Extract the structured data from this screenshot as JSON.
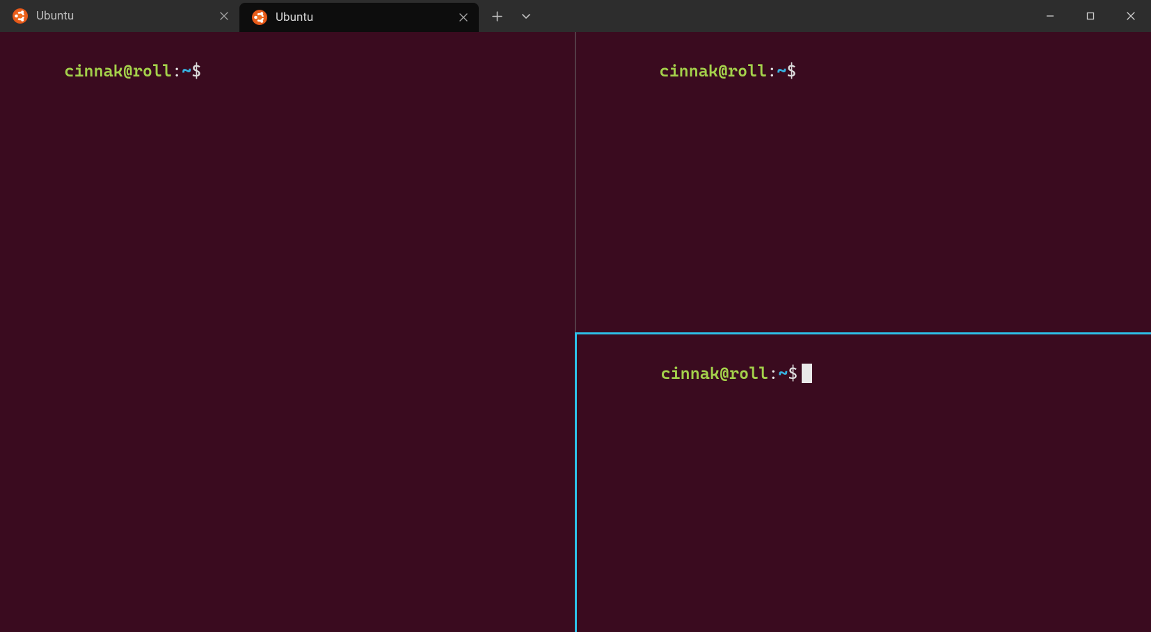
{
  "tabs": [
    {
      "label": "Ubuntu",
      "active": false
    },
    {
      "label": "Ubuntu",
      "active": true
    }
  ],
  "prompt": {
    "userhost": "cinnak@roll",
    "sep": ":",
    "path": "~",
    "sigil": "$"
  },
  "panes": {
    "left": {
      "has_cursor": false
    },
    "right_top": {
      "has_cursor": false
    },
    "right_bottom": {
      "has_cursor": true
    }
  },
  "colors": {
    "terminal_bg": "#3a0b1f",
    "accent": "#2dc0e8",
    "prompt_user": "#a4d14b",
    "prompt_path": "#37b1e0"
  }
}
